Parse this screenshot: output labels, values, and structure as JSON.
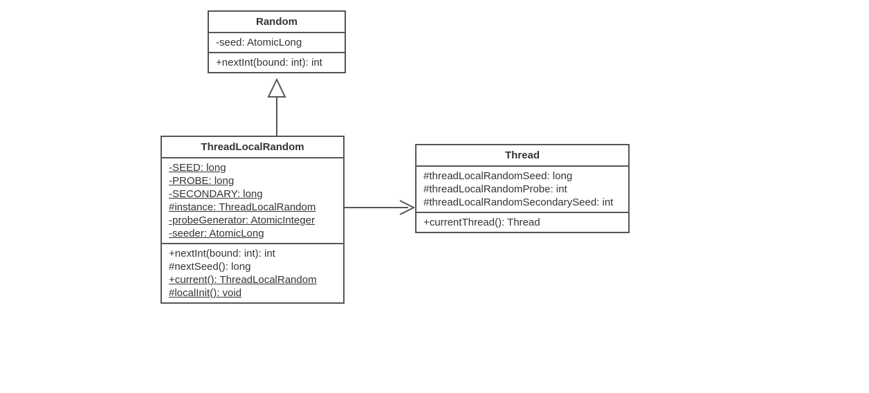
{
  "classes": {
    "random": {
      "name": "Random",
      "attributes": [
        {
          "text": "-seed: AtomicLong",
          "static": false
        }
      ],
      "methods": [
        {
          "text": "+nextInt(bound: int): int",
          "static": false
        }
      ]
    },
    "threadLocalRandom": {
      "name": "ThreadLocalRandom",
      "attributes": [
        {
          "text": "-SEED: long",
          "static": true
        },
        {
          "text": "-PROBE: long",
          "static": true
        },
        {
          "text": "-SECONDARY: long",
          "static": true
        },
        {
          "text": "#instance: ThreadLocalRandom",
          "static": true
        },
        {
          "text": "-probeGenerator: AtomicInteger",
          "static": true
        },
        {
          "text": "-seeder: AtomicLong",
          "static": true
        }
      ],
      "methods": [
        {
          "text": "+nextInt(bound: int): int",
          "static": false
        },
        {
          "text": "#nextSeed(): long",
          "static": false
        },
        {
          "text": "+current(): ThreadLocalRandom",
          "static": true
        },
        {
          "text": "#localInit(): void",
          "static": true
        }
      ]
    },
    "thread": {
      "name": "Thread",
      "attributes": [
        {
          "text": "#threadLocalRandomSeed: long",
          "static": false
        },
        {
          "text": "#threadLocalRandomProbe: int",
          "static": false
        },
        {
          "text": "#threadLocalRandomSecondarySeed: int",
          "static": false
        }
      ],
      "methods": [
        {
          "text": "+currentThread(): Thread",
          "static": false
        }
      ]
    }
  },
  "relationships": [
    {
      "from": "ThreadLocalRandom",
      "to": "Random",
      "type": "generalization"
    },
    {
      "from": "ThreadLocalRandom",
      "to": "Thread",
      "type": "association"
    }
  ]
}
